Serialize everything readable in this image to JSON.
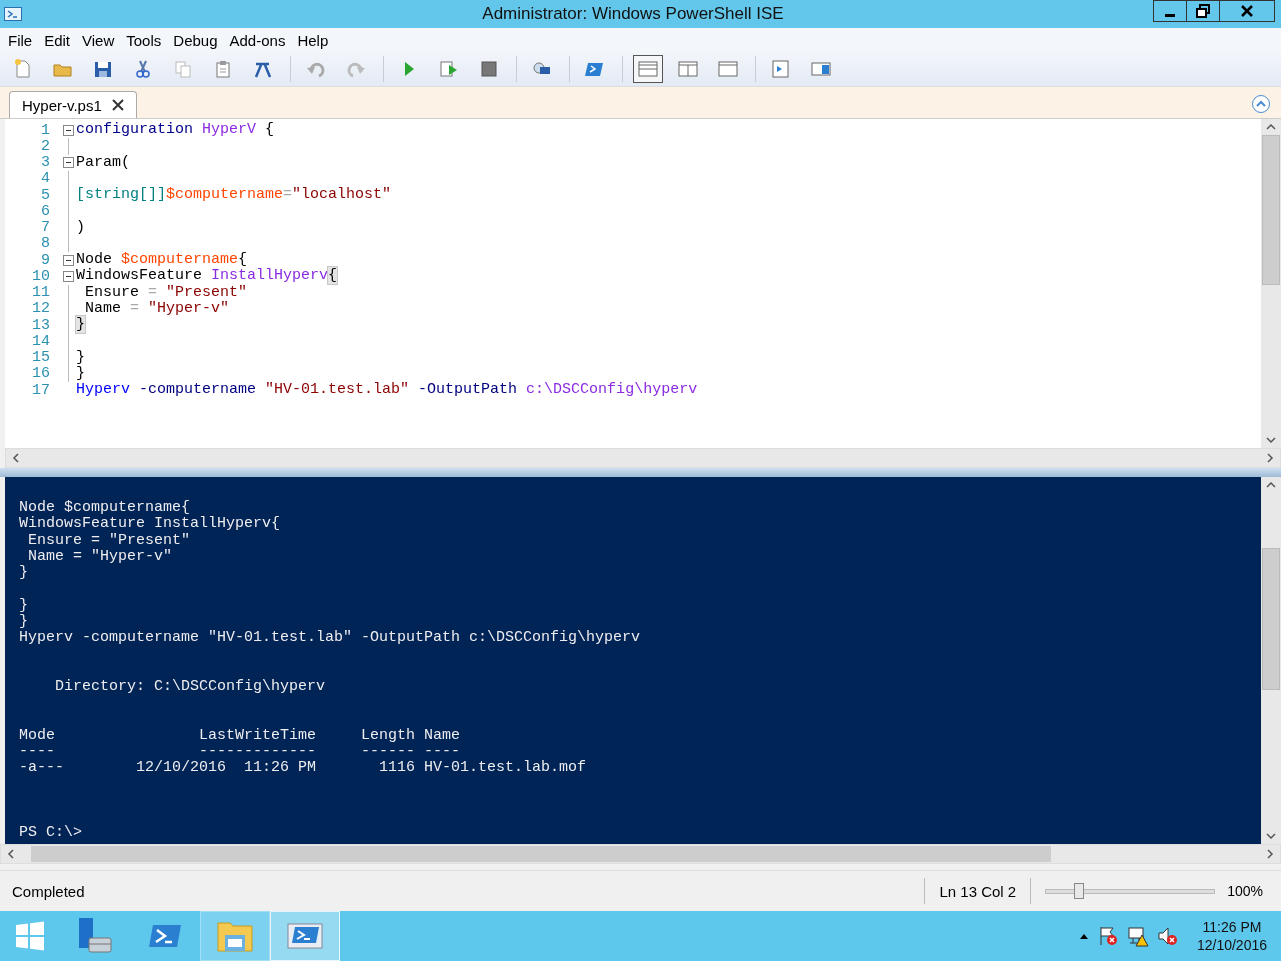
{
  "window": {
    "title": "Administrator: Windows PowerShell ISE"
  },
  "menu": [
    "File",
    "Edit",
    "View",
    "Tools",
    "Debug",
    "Add-ons",
    "Help"
  ],
  "tabs": [
    {
      "label": "Hyper-v.ps1",
      "selected": true
    }
  ],
  "editor": {
    "lines": [
      {
        "number": "1",
        "foldable": true,
        "in_block": false,
        "tokens": [
          {
            "kind": "keyword",
            "text": "configuration "
          },
          {
            "kind": "argument",
            "text": "HyperV"
          },
          {
            "kind": "plain",
            "text": " {"
          }
        ]
      },
      {
        "number": "2",
        "foldable": false,
        "in_block": true
      },
      {
        "number": "3",
        "foldable": true,
        "in_block": false,
        "tokens": [
          {
            "kind": "plain",
            "text": "Param("
          }
        ]
      },
      {
        "number": "4",
        "foldable": false,
        "in_block": true
      },
      {
        "number": "5",
        "foldable": false,
        "in_block": true,
        "tokens": [
          {
            "kind": "type",
            "text": "[string[]]"
          },
          {
            "kind": "variable",
            "text": "$computername"
          },
          {
            "kind": "operator",
            "text": "="
          },
          {
            "kind": "string",
            "text": "\"localhost\""
          }
        ]
      },
      {
        "number": "6",
        "foldable": false,
        "in_block": true
      },
      {
        "number": "7",
        "foldable": false,
        "in_block": true,
        "tokens": [
          {
            "kind": "plain",
            "text": ")"
          }
        ]
      },
      {
        "number": "8",
        "foldable": false,
        "in_block": true
      },
      {
        "number": "9",
        "foldable": true,
        "in_block": false,
        "tokens": [
          {
            "kind": "plain",
            "text": "Node "
          },
          {
            "kind": "variable",
            "text": "$computername"
          },
          {
            "kind": "plain",
            "text": "{"
          }
        ]
      },
      {
        "number": "10",
        "foldable": true,
        "in_block": false,
        "tokens": [
          {
            "kind": "plain",
            "text": "WindowsFeature "
          },
          {
            "kind": "argument",
            "text": "InstallHyperv"
          },
          {
            "kind": "brace-match",
            "text": "{"
          }
        ]
      },
      {
        "number": "11",
        "foldable": false,
        "in_block": true,
        "tokens": [
          {
            "kind": "plain",
            "text": " Ensure "
          },
          {
            "kind": "operator",
            "text": "= "
          },
          {
            "kind": "string",
            "text": "\"Present\""
          }
        ]
      },
      {
        "number": "12",
        "foldable": false,
        "in_block": true,
        "tokens": [
          {
            "kind": "plain",
            "text": " Name "
          },
          {
            "kind": "operator",
            "text": "= "
          },
          {
            "kind": "string",
            "text": "\"Hyper-v\""
          }
        ]
      },
      {
        "number": "13",
        "foldable": false,
        "in_block": true,
        "tokens": [
          {
            "kind": "brace-match",
            "text": "}"
          }
        ]
      },
      {
        "number": "14",
        "foldable": false,
        "in_block": true
      },
      {
        "number": "15",
        "foldable": false,
        "in_block": true,
        "tokens": [
          {
            "kind": "plain",
            "text": "}"
          }
        ]
      },
      {
        "number": "16",
        "foldable": false,
        "in_block": true,
        "tokens": [
          {
            "kind": "plain",
            "text": "}"
          }
        ]
      },
      {
        "number": "17",
        "foldable": false,
        "in_block": false,
        "tokens": [
          {
            "kind": "command",
            "text": "Hyperv "
          },
          {
            "kind": "parameter",
            "text": "-computername "
          },
          {
            "kind": "string",
            "text": "\"HV-01.test.lab\" "
          },
          {
            "kind": "parameter",
            "text": "-OutputPath "
          },
          {
            "kind": "argument",
            "text": "c:\\DSCConfig\\hyperv"
          }
        ]
      }
    ]
  },
  "console": {
    "lines": [
      {
        "kind": "text",
        "text": "Node $computername{"
      },
      {
        "kind": "text",
        "text": "WindowsFeature InstallHyperv{"
      },
      {
        "kind": "text",
        "text": " Ensure = \"Present\""
      },
      {
        "kind": "text",
        "text": " Name = \"Hyper-v\""
      },
      {
        "kind": "text",
        "text": "}"
      },
      {
        "kind": "blank"
      },
      {
        "kind": "text",
        "text": "}"
      },
      {
        "kind": "text",
        "text": "}"
      },
      {
        "kind": "text",
        "text": "Hyperv -computername \"HV-01.test.lab\" -OutputPath c:\\DSCConfig\\hyperv"
      },
      {
        "kind": "blank"
      },
      {
        "kind": "blank"
      },
      {
        "kind": "text",
        "text": "    Directory: C:\\DSCConfig\\hyperv"
      },
      {
        "kind": "blank"
      },
      {
        "kind": "blank"
      },
      {
        "kind": "text",
        "text": "Mode                LastWriteTime     Length Name"
      },
      {
        "kind": "text",
        "text": "----                -------------     ------ ----"
      },
      {
        "kind": "text",
        "text": "-a---        12/10/2016  11:26 PM       1116 HV-01.test.lab.mof"
      },
      {
        "kind": "blank"
      },
      {
        "kind": "blank"
      },
      {
        "kind": "blank"
      },
      {
        "kind": "text",
        "text": "PS C:\\>"
      }
    ]
  },
  "status_bar": {
    "message": "Completed",
    "position": "Ln 13  Col 2",
    "zoom": {
      "level": 0.2
    },
    "zoom_reading": "100%"
  },
  "taskbar": {
    "apps": [
      {
        "kind": "server-manager",
        "running": false,
        "selected": false
      },
      {
        "kind": "powershell",
        "running": false,
        "selected": false
      },
      {
        "kind": "explorer",
        "running": true,
        "selected": false
      },
      {
        "kind": "ise",
        "running": true,
        "selected": true
      }
    ],
    "time": "11:26 PM",
    "date": "12/10/2016"
  }
}
